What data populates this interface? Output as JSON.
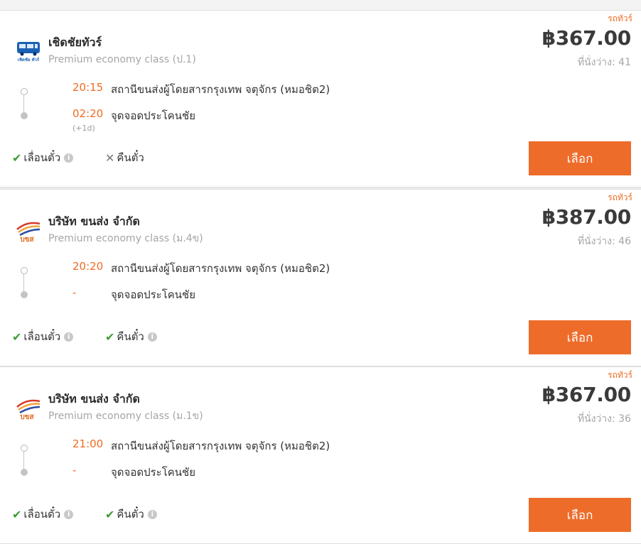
{
  "colors": {
    "accent": "#ee6c2a",
    "time": "#ef6c22",
    "ok": "#3f9c35"
  },
  "results": [
    {
      "bus_type": "รถทัวร์",
      "operator": "เชิดชัยทัวร์",
      "logo_icon": "chertchai-tour-logo",
      "class": "Premium economy class (ป.1)",
      "price": "฿367.00",
      "seats": "ที่นั่งว่าง: 41",
      "departure": {
        "time": "20:15",
        "place": "สถานีขนส่งผู้โดยสารกรุงเทพ จตุจักร (หมอชิต2)"
      },
      "arrival": {
        "time": "02:20",
        "place": "จุดจอดประโคนชัย",
        "day_offset": "(+1d)"
      },
      "policies": [
        {
          "label": "เลื่อนตั๋ว",
          "allowed": true,
          "mark": "✔",
          "info": "i"
        },
        {
          "label": "คืนตั๋ว",
          "allowed": false,
          "mark": "✕",
          "info": ""
        }
      ],
      "select_label": "เลือก"
    },
    {
      "bus_type": "รถทัวร์",
      "operator": "บริษัท ขนส่ง จำกัด",
      "logo_icon": "bks-logo",
      "class": "Premium economy class (ม.4ข)",
      "price": "฿387.00",
      "seats": "ที่นั่งว่าง: 46",
      "departure": {
        "time": "20:20",
        "place": "สถานีขนส่งผู้โดยสารกรุงเทพ จตุจักร (หมอชิต2)"
      },
      "arrival": {
        "time": "-",
        "place": "จุดจอดประโคนชัย",
        "day_offset": ""
      },
      "policies": [
        {
          "label": "เลื่อนตั๋ว",
          "allowed": true,
          "mark": "✔",
          "info": "i"
        },
        {
          "label": "คืนตั๋ว",
          "allowed": true,
          "mark": "✔",
          "info": "i"
        }
      ],
      "select_label": "เลือก"
    },
    {
      "bus_type": "รถทัวร์",
      "operator": "บริษัท ขนส่ง จำกัด",
      "logo_icon": "bks-logo",
      "class": "Premium economy class (ม.1ข)",
      "price": "฿367.00",
      "seats": "ที่นั่งว่าง: 36",
      "departure": {
        "time": "21:00",
        "place": "สถานีขนส่งผู้โดยสารกรุงเทพ จตุจักร (หมอชิต2)"
      },
      "arrival": {
        "time": "-",
        "place": "จุดจอดประโคนชัย",
        "day_offset": ""
      },
      "policies": [
        {
          "label": "เลื่อนตั๋ว",
          "allowed": true,
          "mark": "✔",
          "info": "i"
        },
        {
          "label": "คืนตั๋ว",
          "allowed": true,
          "mark": "✔",
          "info": "i"
        }
      ],
      "select_label": "เลือก"
    }
  ],
  "logos": {
    "chertchai_text": "เชิดชัย ทัวร์",
    "bks_text": "บขส"
  }
}
